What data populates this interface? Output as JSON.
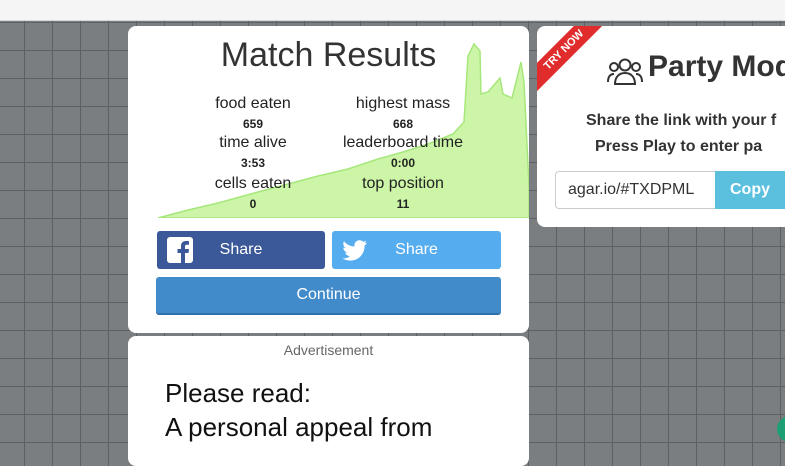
{
  "results": {
    "title": "Match Results",
    "stats": [
      {
        "label": "food eaten",
        "value": "659"
      },
      {
        "label": "highest mass",
        "value": "668"
      },
      {
        "label": "time alive",
        "value": "3:53"
      },
      {
        "label": "leaderboard time",
        "value": "0:00"
      },
      {
        "label": "cells eaten",
        "value": "0"
      },
      {
        "label": "top position",
        "value": "11"
      }
    ],
    "facebook_share": "Share",
    "twitter_share": "Share",
    "continue": "Continue",
    "graph_color": "#ccf5a7"
  },
  "party": {
    "ribbon": "TRY NOW",
    "title": "Party Mod",
    "line1": "Share the link with your f",
    "line2": "Press Play to enter pa",
    "link_value": "agar.io/#TXDPML",
    "copy": "Copy"
  },
  "ad": {
    "label": "Advertisement",
    "line1": "Please read:",
    "line2": "A personal appeal from"
  },
  "colors": {
    "facebook": "#3b5998",
    "twitter": "#55acee",
    "continue": "#428bca",
    "copy": "#5bc0de",
    "ribbon": "#e02c2c"
  }
}
